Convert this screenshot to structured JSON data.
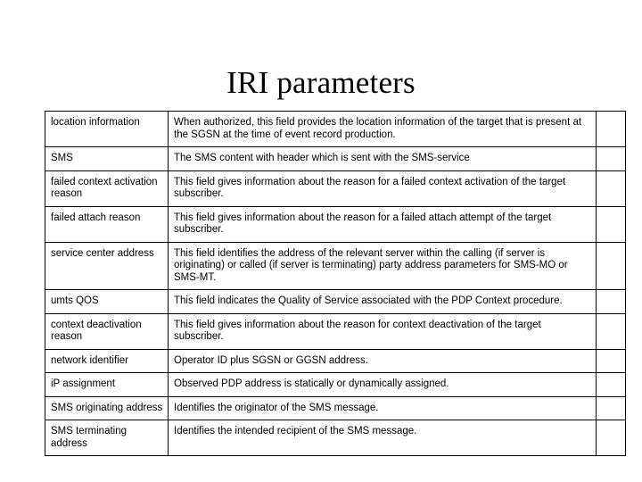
{
  "slide": {
    "title": "IRI parameters"
  },
  "table": {
    "rows": [
      {
        "parameter": "location information",
        "description": "When authorized, this field provides the location information of the target that is present at the SGSN at the time of event record production."
      },
      {
        "parameter": "SMS",
        "description": "The SMS content with header which is sent with the SMS-service"
      },
      {
        "parameter": "failed context activation reason",
        "description": "This field gives information about the reason for a failed context activation of the target subscriber."
      },
      {
        "parameter": "failed attach reason",
        "description": "This field gives information about the reason for a failed attach attempt of the target subscriber."
      },
      {
        "parameter": "service center address",
        "description": "This field identifies the address of the relevant server within the calling (if server is originating) or called (if server is terminating) party address parameters for SMS-MO or SMS-MT."
      },
      {
        "parameter": "umts QOS",
        "description": "This field indicates the Quality of Service associated with the PDP Context procedure."
      },
      {
        "parameter": "context deactivation reason",
        "description": "This field gives information about the reason for context deactivation of the target subscriber."
      },
      {
        "parameter": "network identifier",
        "description": "Operator ID plus SGSN or GGSN address."
      },
      {
        "parameter": "iP assignment",
        "description": "Observed PDP address is statically or dynamically assigned."
      },
      {
        "parameter": "SMS originating address",
        "description": "Identifies the originator of the SMS message."
      },
      {
        "parameter": "SMS terminating address",
        "description": "Identifies the intended recipient of the SMS message."
      }
    ]
  }
}
